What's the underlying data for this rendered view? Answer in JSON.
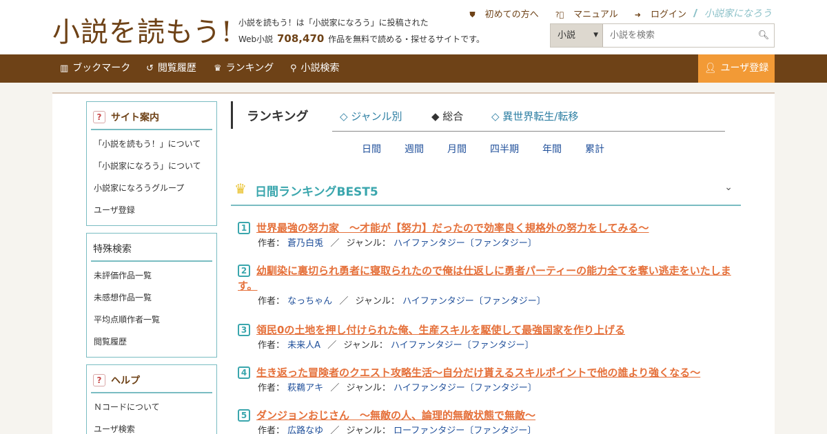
{
  "header": {
    "logo_text": "小説を読もう!",
    "tagline_line1": "小説を読もう！は「小説家になろう」に投稿された",
    "tagline_prefix": "Web小説",
    "novel_count": "708,470",
    "tagline_suffix": "作品を無料で読める・探せるサイトです。",
    "links": {
      "first_time": "初めての方へ",
      "manual": "マニュアル",
      "login": "ログイン",
      "narou_logo": "小説家になろう"
    },
    "search": {
      "category": "小説",
      "placeholder": "小説を検索"
    }
  },
  "nav": {
    "bookmark": "ブックマーク",
    "history": "閲覧履歴",
    "ranking": "ランキング",
    "search": "小説検索",
    "register": "ユーザ登録"
  },
  "sidebar": {
    "site_guide": {
      "title": "サイト案内",
      "items": [
        "「小説を読もう！」について",
        "「小説家になろう」について",
        "小説家になろうグループ",
        "ユーザ登録"
      ]
    },
    "special_search": {
      "title": "特殊検索",
      "items": [
        "未評価作品一覧",
        "未感想作品一覧",
        "平均点順作者一覧",
        "閲覧履歴"
      ]
    },
    "help": {
      "title": "ヘルプ",
      "items": [
        "Ｎコードについて",
        "ユーザ検索"
      ]
    }
  },
  "main": {
    "ranking_title": "ランキング",
    "tabs": [
      "◇ ジャンル別",
      "◆ 総合",
      "◇ 異世界転生/転移"
    ],
    "periods": [
      "日間",
      "週間",
      "月間",
      "四半期",
      "年間",
      "累計"
    ],
    "best_title": "日間ランキングBEST5",
    "author_label": "作者：",
    "genre_label": "ジャンル：",
    "separator": "／",
    "rankings": [
      {
        "rank": "1",
        "title": "世界最強の努力家　～才能が【努力】だったので効率良く規格外の努力をしてみる～",
        "author": "蒼乃白兎",
        "genre": "ハイファンタジー〔ファンタジー〕"
      },
      {
        "rank": "2",
        "title": "幼馴染に裏切られ勇者に寝取られたので俺は仕返しに勇者パーティーの能力全てを奪い逃走をいたします。",
        "author": "なっちゃん",
        "genre": "ハイファンタジー〔ファンタジー〕"
      },
      {
        "rank": "3",
        "title": "領民0の土地を押し付けられた俺、生産スキルを駆使して最強国家を作り上げる",
        "author": "未来人A",
        "genre": "ハイファンタジー〔ファンタジー〕"
      },
      {
        "rank": "4",
        "title": "生き返った冒険者のクエスト攻略生活～自分だけ貰えるスキルポイントで他の誰より強くなる～",
        "author": "萩鵜アキ",
        "genre": "ハイファンタジー〔ファンタジー〕"
      },
      {
        "rank": "5",
        "title": "ダンジョンおじさん　～無敵の人、論理的無敵状態で無敵～",
        "author": "広路なゆ",
        "genre": "ローファンタジー〔ファンタジー〕"
      }
    ]
  },
  "colors": {
    "brand_brown": "#6e4217",
    "accent_orange": "#f29a36",
    "teal": "#3aa6ad",
    "title_orange": "#e5703a",
    "link_blue": "#1f4f9a"
  }
}
